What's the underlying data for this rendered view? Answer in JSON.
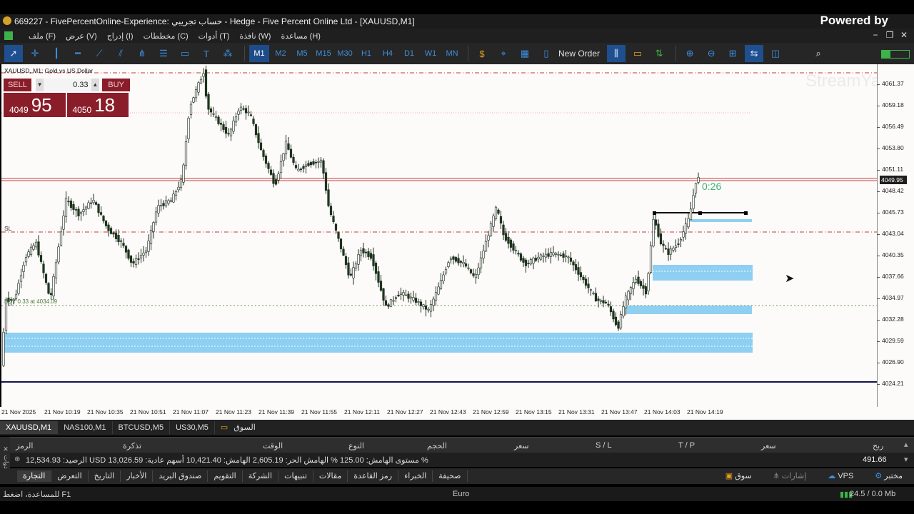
{
  "window": {
    "title": "669227 - FivePercentOnline-Experience: حساب تجريبي - Hedge - Five Percent Online Ltd - [XAUUSD,M1]",
    "powered_by": "Powered by",
    "watermark": "StreamYard"
  },
  "menu": {
    "items": [
      "ملف (F)",
      "عرض (V)",
      "إدراج (I)",
      "مخططات (C)",
      "أدوات (T)",
      "نافذة (W)",
      "مساعدة (H)"
    ]
  },
  "toolbar": {
    "timeframes": [
      "M1",
      "M2",
      "M5",
      "M15",
      "M30",
      "H1",
      "H4",
      "D1",
      "W1",
      "MN"
    ],
    "active_timeframe": "M1",
    "new_order": "New Order"
  },
  "chart": {
    "symbol_label": "XAUUSD, M1: Gold vs US Dollar",
    "countdown": "0:26",
    "sl_label": "SL",
    "buy_label": "BUY 0.33 at 4034.09",
    "price_ticks": [
      "4061.37",
      "4059.18",
      "4056.49",
      "4053.80",
      "4051.11",
      "4048.42",
      "4045.73",
      "4043.04",
      "4040.35",
      "4037.66",
      "4034.97",
      "4032.28",
      "4029.59",
      "4026.90",
      "4024.21"
    ],
    "current_price": "4049.95",
    "time_ticks": [
      "21 Nov 2025",
      "21 Nov 10:19",
      "21 Nov 10:35",
      "21 Nov 10:51",
      "21 Nov 11:07",
      "21 Nov 11:23",
      "21 Nov 11:39",
      "21 Nov 11:55",
      "21 Nov 12:11",
      "21 Nov 12:27",
      "21 Nov 12:43",
      "21 Nov 12:59",
      "21 Nov 13:15",
      "21 Nov 13:31",
      "21 Nov 13:47",
      "21 Nov 14:03",
      "21 Nov 14:19"
    ]
  },
  "one_click": {
    "sell": "SELL",
    "buy": "BUY",
    "lot": "0.33",
    "sell_prefix": "4049",
    "sell_big": "95",
    "buy_prefix": "4050",
    "buy_big": "18"
  },
  "chart_tabs": [
    "XAUUSD,M1",
    "NAS100,M1",
    "BTCUSD,M5",
    "US30,M5",
    "السوق"
  ],
  "terminal": {
    "headers": [
      "الرمز",
      "تذكرة",
      "الوقت",
      "النوع",
      "الحجم",
      "سعر",
      "S / L",
      "T / P",
      "سعر",
      "ربح"
    ],
    "balance_line": "الرصيد: 12,534.93 USD  مستوى الهامش: 125.00 %  الهامش الحر: 2,605.19  الهامش: 10,421.40  أسهم عادية: 13,026.59 %",
    "profit": "491.66",
    "tabs": [
      "التجارة",
      "التعرض",
      "التاريخ",
      "الأخبار",
      "صندوق البريد",
      "التقويم",
      "الشركة",
      "تنبيهات",
      "مقالات",
      "رمز القاعدة",
      "الخبراء",
      "صحيفة"
    ],
    "right_tabs": [
      "سوق",
      "إشارات",
      "VPS",
      "مختبر"
    ],
    "side_label": "الأدوات"
  },
  "status": {
    "help": "للمساعدة، اضغط F1",
    "profile": "Euro",
    "net": "24.5 / 0.0 Mb"
  },
  "colors": {
    "bull": "#ffffff",
    "bear": "#1c3a1c",
    "zone": "#8ecff2",
    "accent": "#1e4c8a"
  }
}
